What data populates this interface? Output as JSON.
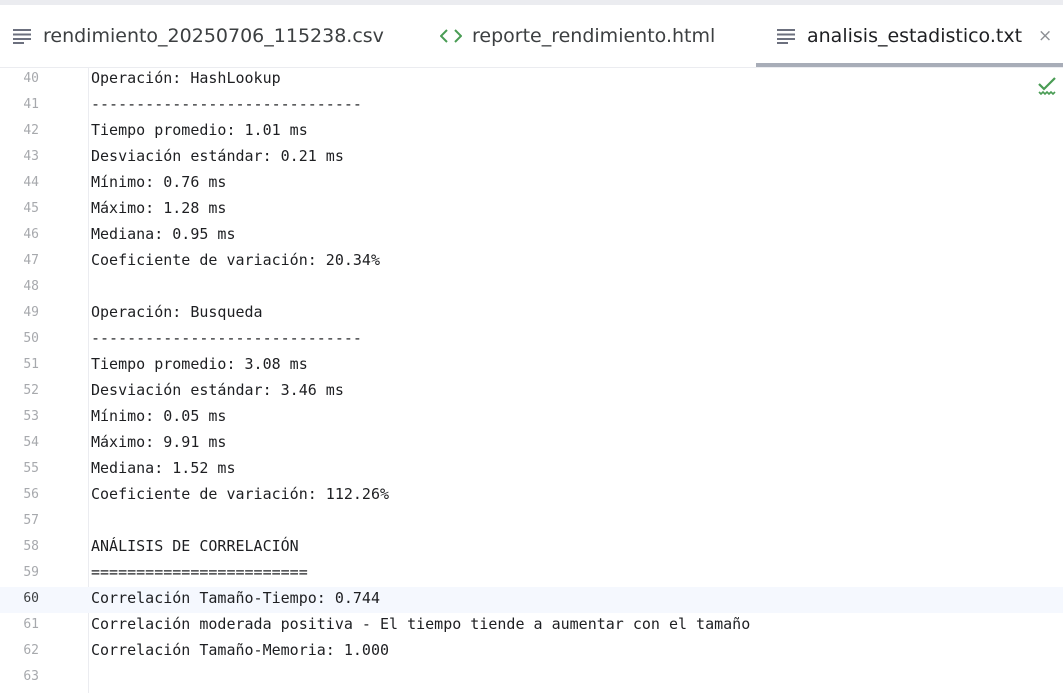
{
  "tabs": [
    {
      "label": "rendimiento_20250706_115238.csv",
      "icon": "text-lines-icon"
    },
    {
      "label": "reporte_rendimiento.html",
      "icon": "html-code-icon"
    },
    {
      "label": "analisis_estadistico.txt",
      "icon": "text-lines-icon",
      "active": true,
      "close": "×"
    }
  ],
  "colors": {
    "accent_underline": "#a8adb8",
    "inspection_ok": "#499c54",
    "html_icon": "#499c54"
  },
  "status": {
    "icon": "inspection-ok-check-icon"
  },
  "editor": {
    "current_line": 60,
    "lines": [
      {
        "n": "40",
        "text": "Operación: HashLookup"
      },
      {
        "n": "41",
        "text": "------------------------------"
      },
      {
        "n": "42",
        "text": "Tiempo promedio: 1.01 ms"
      },
      {
        "n": "43",
        "text": "Desviación estándar: 0.21 ms"
      },
      {
        "n": "44",
        "text": "Mínimo: 0.76 ms"
      },
      {
        "n": "45",
        "text": "Máximo: 1.28 ms"
      },
      {
        "n": "46",
        "text": "Mediana: 0.95 ms"
      },
      {
        "n": "47",
        "text": "Coeficiente de variación: 20.34%"
      },
      {
        "n": "48",
        "text": ""
      },
      {
        "n": "49",
        "text": "Operación: Busqueda"
      },
      {
        "n": "50",
        "text": "------------------------------"
      },
      {
        "n": "51",
        "text": "Tiempo promedio: 3.08 ms"
      },
      {
        "n": "52",
        "text": "Desviación estándar: 3.46 ms"
      },
      {
        "n": "53",
        "text": "Mínimo: 0.05 ms"
      },
      {
        "n": "54",
        "text": "Máximo: 9.91 ms"
      },
      {
        "n": "55",
        "text": "Mediana: 1.52 ms"
      },
      {
        "n": "56",
        "text": "Coeficiente de variación: 112.26%"
      },
      {
        "n": "57",
        "text": ""
      },
      {
        "n": "58",
        "text": "ANÁLISIS DE CORRELACIÓN"
      },
      {
        "n": "59",
        "text": "========================"
      },
      {
        "n": "60",
        "text": "Correlación Tamaño-Tiempo: 0.744"
      },
      {
        "n": "61",
        "text": "Correlación moderada positiva - El tiempo tiende a aumentar con el tamaño"
      },
      {
        "n": "62",
        "text": "Correlación Tamaño-Memoria: 1.000"
      },
      {
        "n": "63",
        "text": ""
      }
    ]
  }
}
